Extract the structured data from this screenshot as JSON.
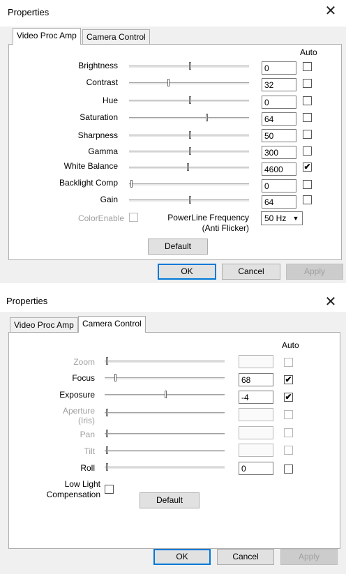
{
  "dialog1": {
    "title": "Properties",
    "tabs": [
      {
        "label": "Video Proc Amp"
      },
      {
        "label": "Camera Control"
      }
    ],
    "auto_label": "Auto",
    "rows": [
      {
        "label": "Brightness",
        "value": "0",
        "auto": false
      },
      {
        "label": "Contrast",
        "value": "32",
        "auto": false
      },
      {
        "label": "Hue",
        "value": "0",
        "auto": false
      },
      {
        "label": "Saturation",
        "value": "64",
        "auto": false
      },
      {
        "label": "Sharpness",
        "value": "50",
        "auto": false
      },
      {
        "label": "Gamma",
        "value": "300",
        "auto": false
      },
      {
        "label": "White Balance",
        "value": "4600",
        "auto": true
      },
      {
        "label": "Backlight Comp",
        "value": "0",
        "auto": false
      },
      {
        "label": "Gain",
        "value": "64",
        "auto": false
      }
    ],
    "color_enable_label": "ColorEnable",
    "powerline_label": "PowerLine Frequency",
    "powerline_sub": "(Anti Flicker)",
    "powerline_value": "50 Hz",
    "default_label": "Default",
    "ok_label": "OK",
    "cancel_label": "Cancel",
    "apply_label": "Apply"
  },
  "dialog2": {
    "title": "Properties",
    "tabs": [
      {
        "label": "Video Proc Amp"
      },
      {
        "label": "Camera Control"
      }
    ],
    "auto_label": "Auto",
    "rows": [
      {
        "label": "Zoom",
        "value": "",
        "auto": false,
        "enabled": false
      },
      {
        "label": "Focus",
        "value": "68",
        "auto": true,
        "enabled": true
      },
      {
        "label": "Exposure",
        "value": "-4",
        "auto": true,
        "enabled": true
      },
      {
        "label": "Aperture",
        "label2": "(Iris)",
        "value": "",
        "auto": false,
        "enabled": false
      },
      {
        "label": "Pan",
        "value": "",
        "auto": false,
        "enabled": false
      },
      {
        "label": "Tilt",
        "value": "",
        "auto": false,
        "enabled": false
      },
      {
        "label": "Roll",
        "value": "0",
        "auto": false,
        "enabled": true
      }
    ],
    "low_light_label": "Low Light",
    "low_light_sub": "Compensation",
    "default_label": "Default",
    "ok_label": "OK",
    "cancel_label": "Cancel",
    "apply_label": "Apply"
  },
  "check_glyph": "✔",
  "close_glyph": "✕",
  "dropdown_glyph": "▼"
}
